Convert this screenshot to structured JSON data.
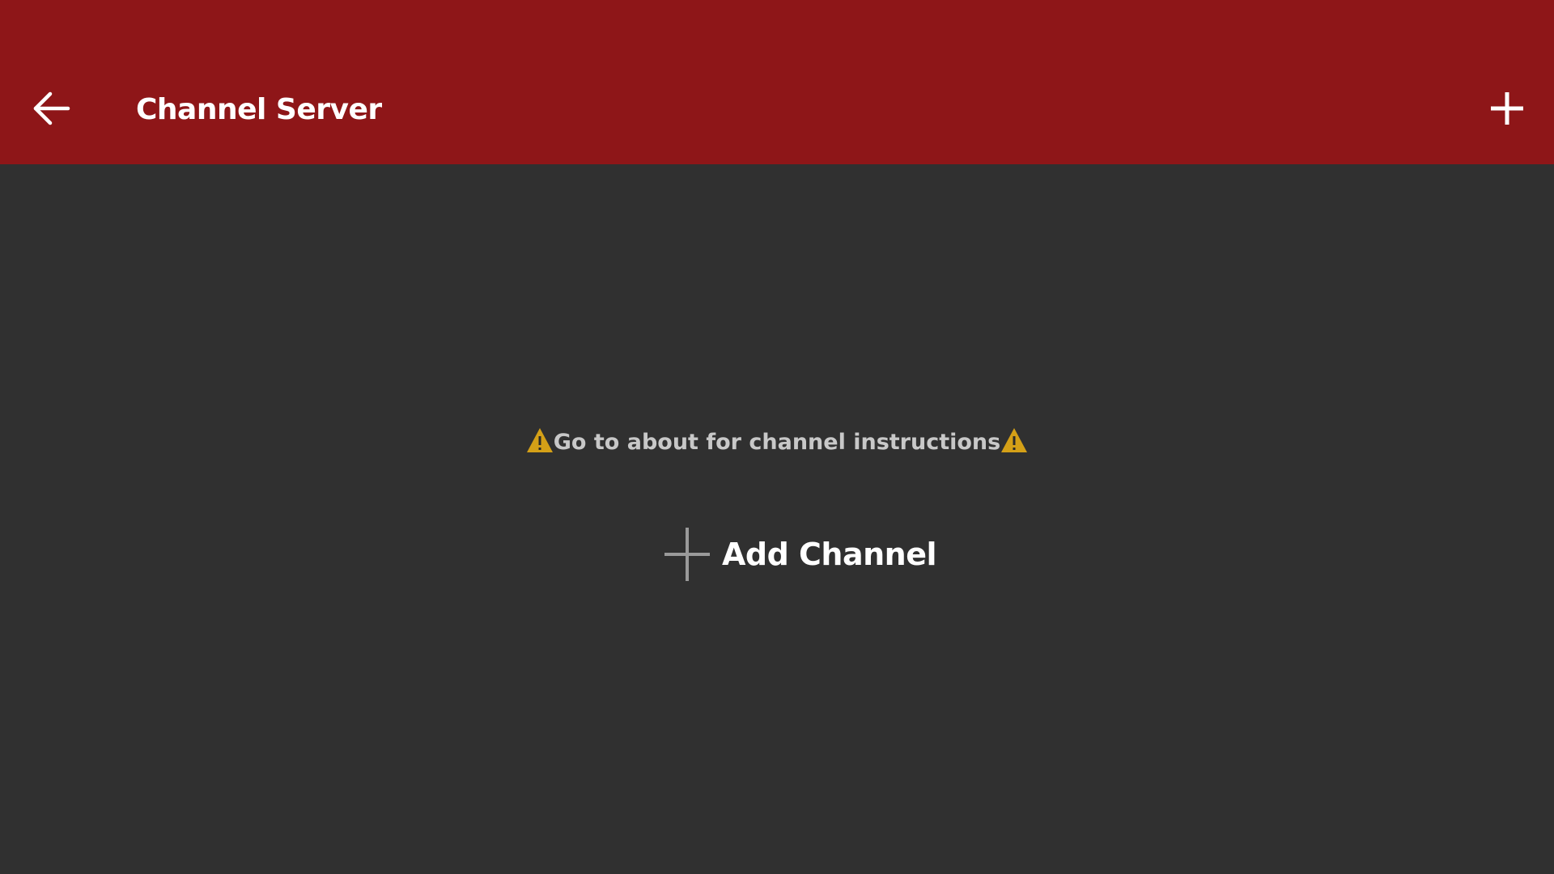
{
  "colors": {
    "toolbar_bg": "#8e1618",
    "content_bg": "#303030",
    "title_text": "#ffffff",
    "notice_text": "#c8c8c8",
    "warning_icon": "#d4a017",
    "plus_icon_muted": "#9a9a9a"
  },
  "toolbar": {
    "back_icon": "arrow-left-icon",
    "title": "Channel Server",
    "add_icon": "plus-icon"
  },
  "main": {
    "notice_icon": "warning-icon",
    "notice_text": "Go to about for channel instructions",
    "add_channel_icon": "plus-icon",
    "add_channel_label": "Add Channel"
  }
}
